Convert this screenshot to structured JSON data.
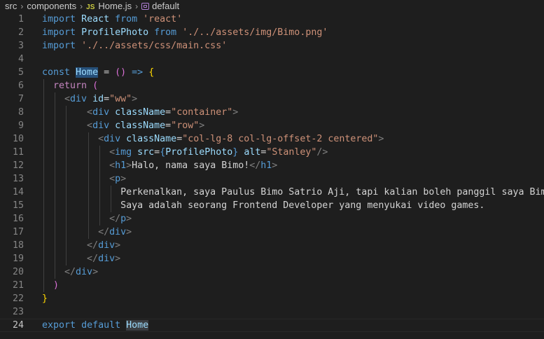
{
  "breadcrumb": {
    "parts": [
      "src",
      "components",
      "Home.js",
      "default"
    ],
    "file_badge": "JS"
  },
  "editor": {
    "current_line": 24,
    "lines": [
      {
        "n": 1,
        "tokens": [
          [
            "kw",
            "import"
          ],
          [
            "text",
            " "
          ],
          [
            "var",
            "React"
          ],
          [
            "text",
            " "
          ],
          [
            "kw",
            "from"
          ],
          [
            "text",
            " "
          ],
          [
            "str",
            "'react'"
          ]
        ]
      },
      {
        "n": 2,
        "tokens": [
          [
            "kw",
            "import"
          ],
          [
            "text",
            " "
          ],
          [
            "var",
            "ProfilePhoto"
          ],
          [
            "text",
            " "
          ],
          [
            "kw",
            "from"
          ],
          [
            "text",
            " "
          ],
          [
            "str",
            "'./../assets/img/Bimo.png'"
          ]
        ]
      },
      {
        "n": 3,
        "tokens": [
          [
            "kw",
            "import"
          ],
          [
            "text",
            " "
          ],
          [
            "str",
            "'./../assets/css/main.css'"
          ]
        ]
      },
      {
        "n": 4,
        "tokens": []
      },
      {
        "n": 5,
        "tokens": [
          [
            "kw",
            "const"
          ],
          [
            "text",
            " "
          ],
          [
            "hl",
            "Home"
          ],
          [
            "text",
            " "
          ],
          [
            "op",
            "="
          ],
          [
            "text",
            " "
          ],
          [
            "paren",
            "()"
          ],
          [
            "text",
            " "
          ],
          [
            "kw",
            "=>"
          ],
          [
            "text",
            " "
          ],
          [
            "brace",
            "{"
          ]
        ]
      },
      {
        "n": 6,
        "tokens": [
          [
            "text",
            "  "
          ],
          [
            "ctl",
            "return"
          ],
          [
            "text",
            " "
          ],
          [
            "paren",
            "("
          ]
        ]
      },
      {
        "n": 7,
        "tokens": [
          [
            "text",
            "    "
          ],
          [
            "punct",
            "<"
          ],
          [
            "tag",
            "div"
          ],
          [
            "text",
            " "
          ],
          [
            "attr",
            "id"
          ],
          [
            "op",
            "="
          ],
          [
            "str",
            "\"ww\""
          ],
          [
            "punct",
            ">"
          ]
        ]
      },
      {
        "n": 8,
        "tokens": [
          [
            "text",
            "        "
          ],
          [
            "punct",
            "<"
          ],
          [
            "tag",
            "div"
          ],
          [
            "text",
            " "
          ],
          [
            "attr",
            "className"
          ],
          [
            "op",
            "="
          ],
          [
            "str",
            "\"container\""
          ],
          [
            "punct",
            ">"
          ]
        ]
      },
      {
        "n": 9,
        "tokens": [
          [
            "text",
            "        "
          ],
          [
            "punct",
            "<"
          ],
          [
            "tag",
            "div"
          ],
          [
            "text",
            " "
          ],
          [
            "attr",
            "className"
          ],
          [
            "op",
            "="
          ],
          [
            "str",
            "\"row\""
          ],
          [
            "punct",
            ">"
          ]
        ]
      },
      {
        "n": 10,
        "tokens": [
          [
            "text",
            "          "
          ],
          [
            "punct",
            "<"
          ],
          [
            "tag",
            "div"
          ],
          [
            "text",
            " "
          ],
          [
            "attr",
            "className"
          ],
          [
            "op",
            "="
          ],
          [
            "str",
            "\"col-lg-8 col-lg-offset-2 centered\""
          ],
          [
            "punct",
            ">"
          ]
        ]
      },
      {
        "n": 11,
        "tokens": [
          [
            "text",
            "            "
          ],
          [
            "punct",
            "<"
          ],
          [
            "tag",
            "img"
          ],
          [
            "text",
            " "
          ],
          [
            "attr",
            "src"
          ],
          [
            "op",
            "="
          ],
          [
            "tag",
            "{"
          ],
          [
            "var",
            "ProfilePhoto"
          ],
          [
            "tag",
            "}"
          ],
          [
            "text",
            " "
          ],
          [
            "attr",
            "alt"
          ],
          [
            "op",
            "="
          ],
          [
            "str",
            "\"Stanley\""
          ],
          [
            "punct",
            "/>"
          ]
        ]
      },
      {
        "n": 12,
        "tokens": [
          [
            "text",
            "            "
          ],
          [
            "punct",
            "<"
          ],
          [
            "tag",
            "h1"
          ],
          [
            "punct",
            ">"
          ],
          [
            "text",
            "Halo, nama saya Bimo!"
          ],
          [
            "punct",
            "</"
          ],
          [
            "tag",
            "h1"
          ],
          [
            "punct",
            ">"
          ]
        ]
      },
      {
        "n": 13,
        "tokens": [
          [
            "text",
            "            "
          ],
          [
            "punct",
            "<"
          ],
          [
            "tag",
            "p"
          ],
          [
            "punct",
            ">"
          ]
        ]
      },
      {
        "n": 14,
        "tokens": [
          [
            "text",
            "              Perkenalkan, saya Paulus Bimo Satrio Aji, tapi kalian boleh panggil saya Bimo."
          ]
        ]
      },
      {
        "n": 15,
        "tokens": [
          [
            "text",
            "              Saya adalah seorang Frontend Developer yang menyukai video games."
          ]
        ]
      },
      {
        "n": 16,
        "tokens": [
          [
            "text",
            "            "
          ],
          [
            "punct",
            "</"
          ],
          [
            "tag",
            "p"
          ],
          [
            "punct",
            ">"
          ]
        ]
      },
      {
        "n": 17,
        "tokens": [
          [
            "text",
            "          "
          ],
          [
            "punct",
            "</"
          ],
          [
            "tag",
            "div"
          ],
          [
            "punct",
            ">"
          ]
        ]
      },
      {
        "n": 18,
        "tokens": [
          [
            "text",
            "        "
          ],
          [
            "punct",
            "</"
          ],
          [
            "tag",
            "div"
          ],
          [
            "punct",
            ">"
          ]
        ]
      },
      {
        "n": 19,
        "tokens": [
          [
            "text",
            "        "
          ],
          [
            "punct",
            "</"
          ],
          [
            "tag",
            "div"
          ],
          [
            "punct",
            ">"
          ]
        ]
      },
      {
        "n": 20,
        "tokens": [
          [
            "text",
            "    "
          ],
          [
            "punct",
            "</"
          ],
          [
            "tag",
            "div"
          ],
          [
            "punct",
            ">"
          ]
        ]
      },
      {
        "n": 21,
        "tokens": [
          [
            "text",
            "  "
          ],
          [
            "paren",
            ")"
          ]
        ]
      },
      {
        "n": 22,
        "tokens": [
          [
            "brace",
            "}"
          ]
        ]
      },
      {
        "n": 23,
        "tokens": []
      },
      {
        "n": 24,
        "tokens": [
          [
            "kw",
            "export"
          ],
          [
            "text",
            " "
          ],
          [
            "kw",
            "default"
          ],
          [
            "text",
            " "
          ],
          [
            "hl2",
            "Home"
          ]
        ]
      }
    ]
  }
}
